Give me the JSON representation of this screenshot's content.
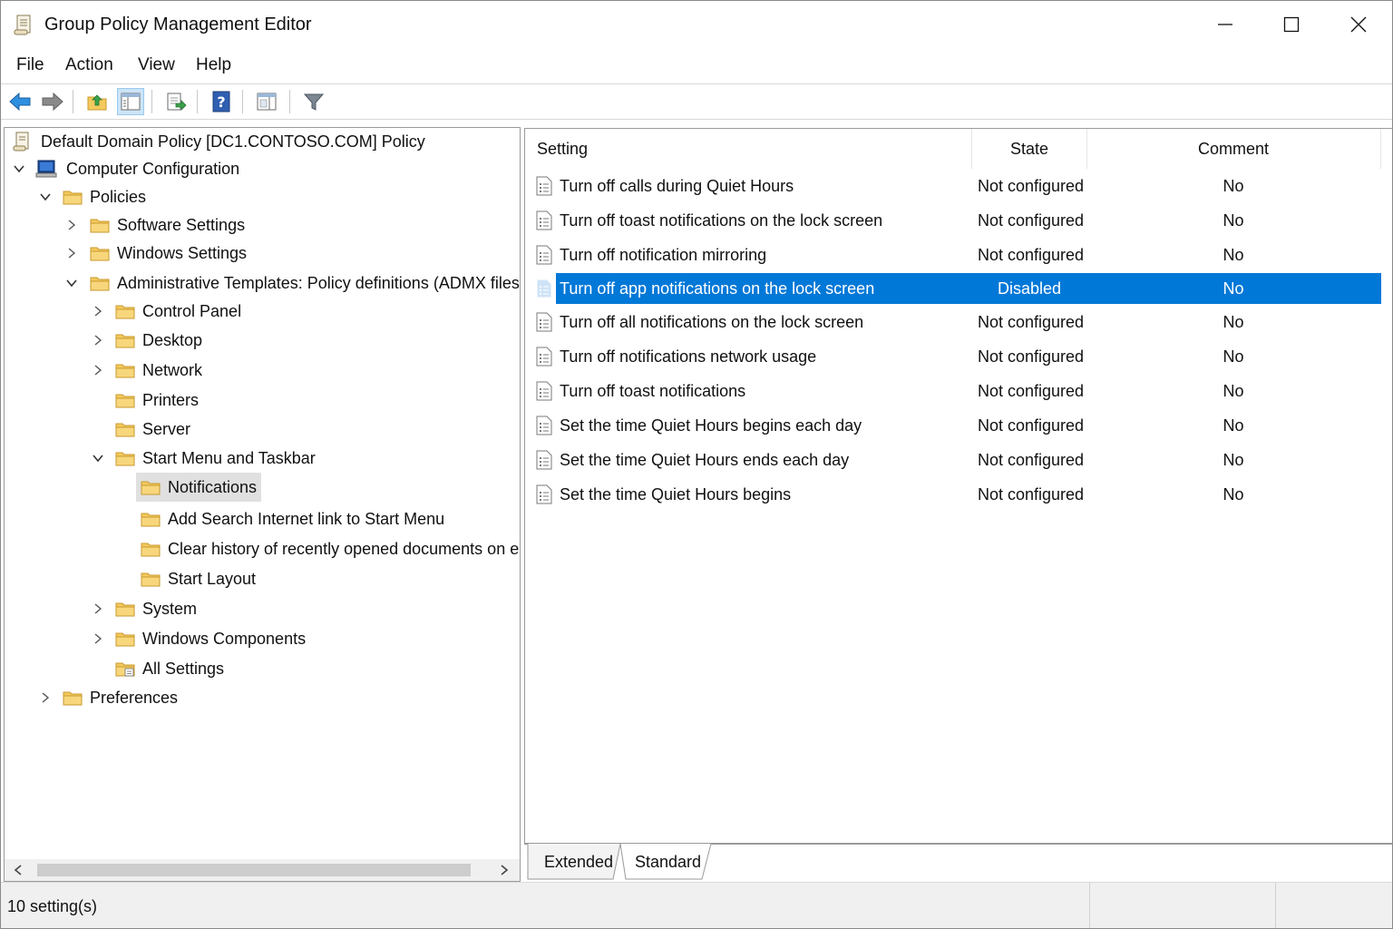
{
  "window": {
    "title": "Group Policy Management Editor"
  },
  "menu": [
    "File",
    "Action",
    "View",
    "Help"
  ],
  "tree": {
    "root": "Default Domain Policy [DC1.CONTOSO.COM] Policy",
    "items": [
      {
        "label": "Computer Configuration"
      },
      {
        "label": "Policies"
      },
      {
        "label": "Software Settings"
      },
      {
        "label": "Windows Settings"
      },
      {
        "label": "Administrative Templates: Policy definitions (ADMX files)"
      },
      {
        "label": "Control Panel"
      },
      {
        "label": "Desktop"
      },
      {
        "label": "Network"
      },
      {
        "label": "Printers"
      },
      {
        "label": "Server"
      },
      {
        "label": "Start Menu and Taskbar"
      },
      {
        "label": "Notifications"
      },
      {
        "label": "Add Search Internet link to Start Menu"
      },
      {
        "label": "Clear history of recently opened documents on e"
      },
      {
        "label": "Start Layout"
      },
      {
        "label": "System"
      },
      {
        "label": "Windows Components"
      },
      {
        "label": "All Settings"
      },
      {
        "label": "Preferences"
      }
    ]
  },
  "list": {
    "columns": {
      "setting": "Setting",
      "state": "State",
      "comment": "Comment"
    },
    "rows": [
      {
        "setting": "Turn off calls during Quiet Hours",
        "state": "Not configured",
        "comment": "No"
      },
      {
        "setting": "Turn off toast notifications on the lock screen",
        "state": "Not configured",
        "comment": "No"
      },
      {
        "setting": "Turn off notification mirroring",
        "state": "Not configured",
        "comment": "No"
      },
      {
        "setting": "Turn off app notifications on the lock screen",
        "state": "Disabled",
        "comment": "No"
      },
      {
        "setting": "Turn off all notifications on the lock screen",
        "state": "Not configured",
        "comment": "No"
      },
      {
        "setting": "Turn off notifications network usage",
        "state": "Not configured",
        "comment": "No"
      },
      {
        "setting": "Turn off toast notifications",
        "state": "Not configured",
        "comment": "No"
      },
      {
        "setting": "Set the time Quiet Hours begins each day",
        "state": "Not configured",
        "comment": "No"
      },
      {
        "setting": "Set the time Quiet Hours ends each day",
        "state": "Not configured",
        "comment": "No"
      },
      {
        "setting": "Set the time Quiet Hours begins",
        "state": "Not configured",
        "comment": "No"
      }
    ]
  },
  "tabs": {
    "extended": "Extended",
    "standard": "Standard"
  },
  "status": {
    "text": "10 setting(s)"
  },
  "colors": {
    "selection": "#0078d7",
    "folder": "#f4c95d",
    "tree_selection": "#e0e0e0"
  }
}
